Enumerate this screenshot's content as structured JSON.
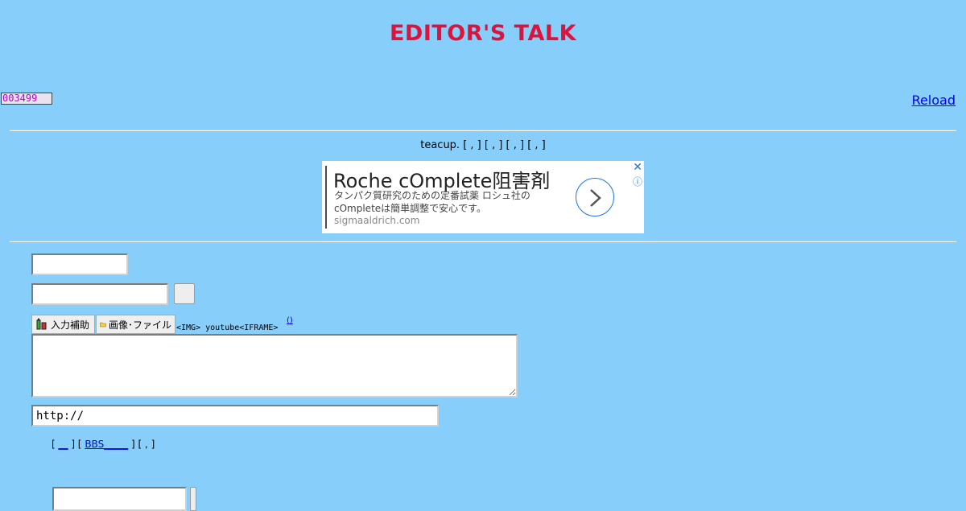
{
  "header": {
    "title": "EDITOR'S TALK"
  },
  "counter": {
    "value": "003499"
  },
  "nav": {
    "reload": "Reload"
  },
  "links_row": {
    "text": "teacup. [ , ] [ , ] [ , ] [ , ]"
  },
  "ad": {
    "headline": "Roche cOmplete阻害剤",
    "body": "タンパク質研究のための定番試薬 ロシュ社のcOmpleteは簡単調整で安心です。",
    "domain": "sigmaaldrich.com",
    "close": "✕",
    "info": "ⓘ"
  },
  "form": {
    "name_value": "",
    "email_value": "",
    "toolbar": {
      "input_assist": "入力補助",
      "image_file": "画像･ファイル",
      "tags": "<IMG> youtube<IFRAME>",
      "help": "()"
    },
    "message_value": "",
    "url_value": "http://",
    "bottom": {
      "open": "[ ",
      "link1": "__",
      "mid": " ] [ ",
      "link2": "BBS_____",
      "close": " ] [ , ]"
    },
    "key_value": ""
  },
  "colors": {
    "background": "#87cefa",
    "title": "#dc143c",
    "link": "#0000ee"
  }
}
